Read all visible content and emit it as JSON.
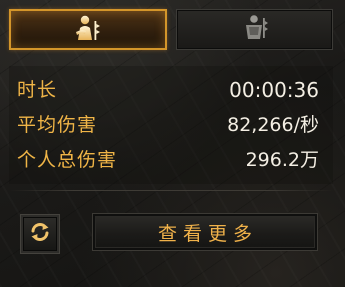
{
  "tabs": [
    {
      "icon": "damage-dealer-icon",
      "selected": true
    },
    {
      "icon": "tank-icon",
      "selected": false
    }
  ],
  "stats": [
    {
      "label": "时长",
      "value": "00:00:36"
    },
    {
      "label": "平均伤害",
      "value": "82,266/秒"
    },
    {
      "label": "个人总伤害",
      "value": "296.2万"
    }
  ],
  "buttons": {
    "refresh_icon": "refresh-icon",
    "view_more_label": "查看更多"
  },
  "colors": {
    "label": "#f0b547",
    "value": "#f4efe4",
    "accent": "#d4962a"
  }
}
